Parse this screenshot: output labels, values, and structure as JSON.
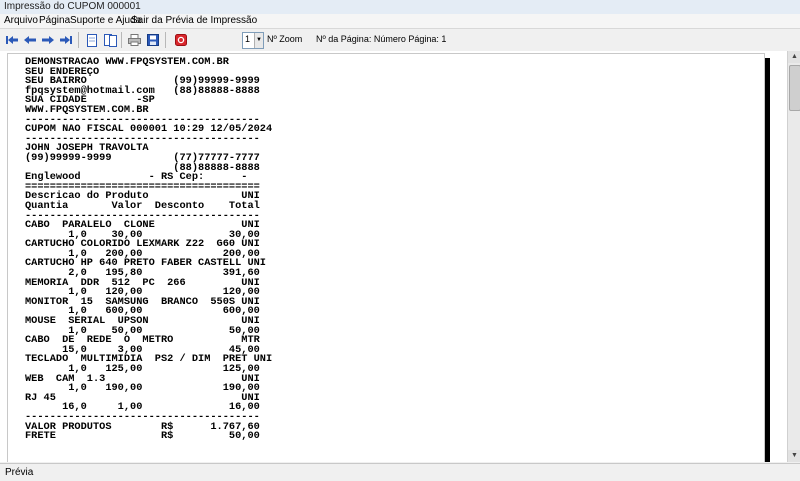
{
  "window": {
    "title": "Impressão do CUPOM 000001"
  },
  "menu": [
    "Arquivo",
    "Página",
    "Suporte e Ajuda",
    "Sair da Prévia de Impressão"
  ],
  "toolbar": {
    "zoom_value": "1",
    "zoom_label": "Nº Zoom",
    "page_label": "Nº da Página: Número Página: 1",
    "icons": [
      "first-page-icon",
      "prev-page-icon",
      "next-page-icon",
      "last-page-icon",
      "single-page-icon",
      "two-pages-icon",
      "print-icon",
      "save-icon",
      "pdf-icon"
    ]
  },
  "receipt": [
    "DEMONSTRACAO WWW.FPQSYSTEM.COM.BR",
    "SEU ENDEREÇO",
    "SEU BAIRRO              (99)99999-9999",
    "fpqsystem@hotmail.com   (88)88888-8888",
    "SUA CIDADE        -SP",
    "WWW.FPQSYSTEM.COM.BR",
    "--------------------------------------",
    "CUPOM NAO FISCAL 000001 10:29 12/05/2024",
    "--------------------------------------",
    "JOHN JOSEPH TRAVOLTA",
    "(99)99999-9999          (77)77777-7777",
    "                        (88)88888-8888",
    "Englewood           - RS Cep:      -",
    "======================================",
    "Descricao do Produto               UNI",
    "Quantia       Valor  Desconto    Total",
    "--------------------------------------",
    "CABO  PARALELO  CLONE              UNI",
    "       1,0    30,00              30,00",
    "CARTUCHO COLORIDO LEXMARK Z22  G60 UNI",
    "       1,0   200,00             200,00",
    "CARTUCHO HP 640 PRETO FABER CASTELL UNI",
    "       2,0   195,80             391,60",
    "MEMORIA  DDR  512  PC  266         UNI",
    "       1,0   120,00             120,00",
    "MONITOR  15  SAMSUNG  BRANCO  550S UNI",
    "       1,0   600,00             600,00",
    "MOUSE  SERIAL  UPSON               UNI",
    "       1,0    50,00              50,00",
    "CABO  DE  REDE  O  METRO           MTR",
    "      15,0     3,00              45,00",
    "TECLADO  MULTIMIDIA  PS2 / DIM  PRET UNI",
    "       1,0   125,00             125,00",
    "WEB  CAM  1.3                      UNI",
    "       1,0   190,00             190,00",
    "RJ 45                              UNI",
    "      16,0     1,00              16,00",
    "--------------------------------------",
    "VALOR PRODUTOS        R$      1.767,60",
    "FRETE                 R$         50,00"
  ],
  "status": {
    "text": "Prévia"
  }
}
